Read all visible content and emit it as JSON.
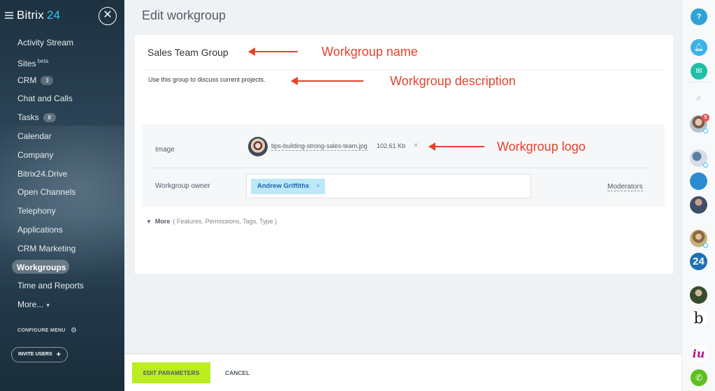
{
  "sidebar": {
    "logo_text": "Bitrix",
    "logo_num": "24",
    "items": [
      {
        "label": "Activity Stream"
      },
      {
        "label": "Sites",
        "sup": "beta"
      },
      {
        "label": "CRM",
        "badge": "3"
      },
      {
        "label": "Chat and Calls"
      },
      {
        "label": "Tasks",
        "badge": "8"
      },
      {
        "label": "Calendar"
      },
      {
        "label": "Company"
      },
      {
        "label": "Bitrix24.Drive"
      },
      {
        "label": "Open Channels"
      },
      {
        "label": "Telephony"
      },
      {
        "label": "Applications"
      },
      {
        "label": "CRM Marketing"
      },
      {
        "label": "Workgroups",
        "active": true
      },
      {
        "label": "Time and Reports"
      },
      {
        "label": "More..."
      }
    ],
    "configure_menu": "CONFIGURE MENU",
    "invite_users": "INVITE USERS"
  },
  "page": {
    "title": "Edit workgroup"
  },
  "form": {
    "name": "Sales Team Group",
    "description": "Use this group to discuss current projects.",
    "image_label": "Image",
    "image_file": "tips-building-strong-sales-team.jpg",
    "image_size": "102.61 Kb",
    "owner_label": "Workgroup owner",
    "owner": "Andrew Griffiths",
    "moderators": "Moderators",
    "more_label": "More",
    "more_sub": "( Features,  Permissions, Tags,  Type  )"
  },
  "annotations": {
    "name": "Workgroup name",
    "description": "Workgroup description",
    "logo": "Workgroup logo"
  },
  "footer": {
    "edit": "EDIT PARAMETERS",
    "cancel": "CANCEL"
  },
  "rail": {
    "help": "?",
    "notification_count": "5",
    "app_24": "24",
    "app_b": "b",
    "app_iu": "iu"
  },
  "colors": {
    "accent": "#2fc6f6",
    "primary_button": "#bbed21",
    "annotation": "#e8412c",
    "owner_tag": "#bce8f7"
  }
}
